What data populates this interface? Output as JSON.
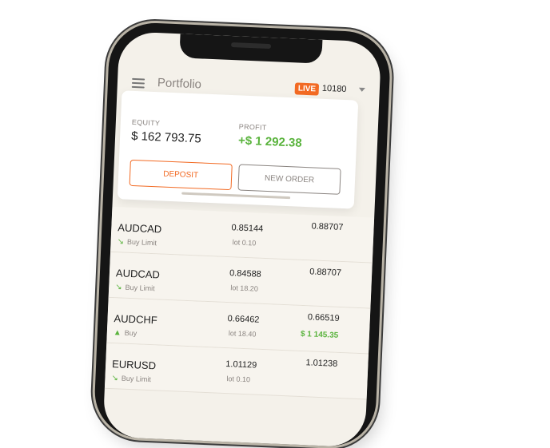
{
  "header": {
    "title": "Portfolio",
    "live_badge": "LIVE",
    "account": "10180"
  },
  "summary": {
    "equity_label": "EQUITY",
    "equity_value": "$ 162 793.75",
    "profit_label": "PROFIT",
    "profit_value": "+$ 1 292.38",
    "deposit_label": "DEPOSIT",
    "new_order_label": "NEW ORDER"
  },
  "colors": {
    "accent": "#f26a23",
    "positive": "#59b33c",
    "background": "#f4f1ea"
  },
  "orders": [
    {
      "symbol": "AUDCAD",
      "type": "Buy Limit",
      "icon": "trend-arrow-icon",
      "price": "0.85144",
      "lot": "lot 0.10",
      "current": "0.88707",
      "pnl": ""
    },
    {
      "symbol": "AUDCAD",
      "type": "Buy Limit",
      "icon": "trend-arrow-icon",
      "price": "0.84588",
      "lot": "lot 18.20",
      "current": "0.88707",
      "pnl": ""
    },
    {
      "symbol": "AUDCHF",
      "type": "Buy",
      "icon": "triangle-up-icon",
      "price": "0.66462",
      "lot": "lot 18.40",
      "current": "0.66519",
      "pnl": "$ 1 145.35"
    },
    {
      "symbol": "EURUSD",
      "type": "Buy Limit",
      "icon": "trend-arrow-icon",
      "price": "1.01129",
      "lot": "lot 0.10",
      "current": "1.01238",
      "pnl": ""
    }
  ]
}
